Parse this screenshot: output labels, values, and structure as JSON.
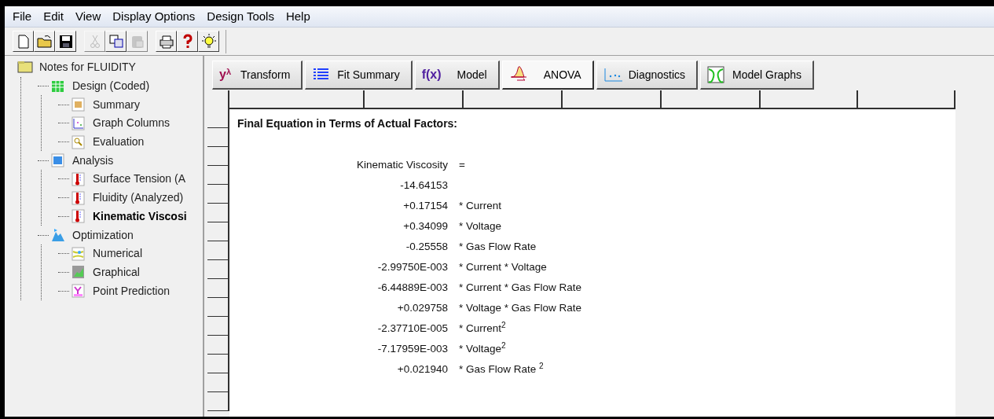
{
  "menu": [
    "File",
    "Edit",
    "View",
    "Display Options",
    "Design Tools",
    "Help"
  ],
  "toolbar": [
    {
      "kind": "new",
      "disabled": false
    },
    {
      "kind": "open",
      "disabled": false
    },
    {
      "kind": "save",
      "disabled": false
    },
    {
      "kind": "cut",
      "disabled": true
    },
    {
      "kind": "copy",
      "disabled": false
    },
    {
      "kind": "paste",
      "disabled": true
    },
    {
      "kind": "print",
      "disabled": false
    },
    {
      "kind": "help",
      "disabled": false
    },
    {
      "kind": "tip",
      "disabled": false
    }
  ],
  "tree": {
    "label": "Notes for FLUIDITY",
    "kind": "folder",
    "selected": false,
    "children": [
      {
        "label": "Design (Coded)",
        "kind": "sheet",
        "selected": false,
        "children": [
          {
            "label": "Summary",
            "kind": "summary",
            "selected": false
          },
          {
            "label": "Graph Columns",
            "kind": "graph",
            "selected": false
          },
          {
            "label": "Evaluation",
            "kind": "eval",
            "selected": false
          }
        ]
      },
      {
        "label": "Analysis",
        "kind": "calc",
        "selected": false,
        "children": [
          {
            "label": "Surface Tension (A",
            "kind": "thermo",
            "selected": false
          },
          {
            "label": "Fluidity (Analyzed)",
            "kind": "thermo",
            "selected": false
          },
          {
            "label": "Kinematic Viscosi",
            "kind": "thermo",
            "selected": true
          }
        ]
      },
      {
        "label": "Optimization",
        "kind": "flask",
        "selected": false,
        "children": [
          {
            "label": "Numerical",
            "kind": "numeric",
            "selected": false
          },
          {
            "label": "Graphical",
            "kind": "graphical",
            "selected": false
          },
          {
            "label": "Point Prediction",
            "kind": "point",
            "selected": false
          }
        ]
      }
    ]
  },
  "tabs": [
    {
      "label": "Transform",
      "kind": "transform",
      "symbol": "y",
      "symbol_sup": "λ",
      "selected": false
    },
    {
      "label": "Fit Summary",
      "kind": "list",
      "selected": false
    },
    {
      "label": "Model",
      "kind": "fx",
      "symbol": "f(x)",
      "selected": false
    },
    {
      "label": "ANOVA",
      "kind": "anova",
      "selected": true
    },
    {
      "label": "Diagnostics",
      "kind": "diag",
      "selected": false
    },
    {
      "label": "Model Graphs",
      "kind": "graphs",
      "selected": false
    }
  ],
  "equation": {
    "heading": "Final Equation in Terms of Actual Factors:",
    "response": "Kinematic Viscosity",
    "equals": "=",
    "terms": [
      {
        "coefficient": "-14.64153"
      },
      {
        "coefficient": "+0.17154",
        "factor": "* Current"
      },
      {
        "coefficient": "+0.34099",
        "factor": "* Voltage"
      },
      {
        "coefficient": "-0.25558",
        "factor": "* Gas Flow Rate"
      },
      {
        "coefficient": "-2.99750E-003",
        "factor": "* Current * Voltage"
      },
      {
        "coefficient": "-6.44889E-003",
        "factor": "* Current * Gas Flow Rate"
      },
      {
        "coefficient": "+0.029758",
        "factor": "* Voltage * Gas Flow Rate"
      },
      {
        "coefficient": "-2.37710E-005",
        "factor": "* Current$^{2}$"
      },
      {
        "coefficient": "-7.17959E-003",
        "factor": "* Voltage$^{2}$"
      },
      {
        "coefficient": "+0.021940",
        "factor": "* Gas Flow Rate $^{2}$"
      }
    ]
  }
}
